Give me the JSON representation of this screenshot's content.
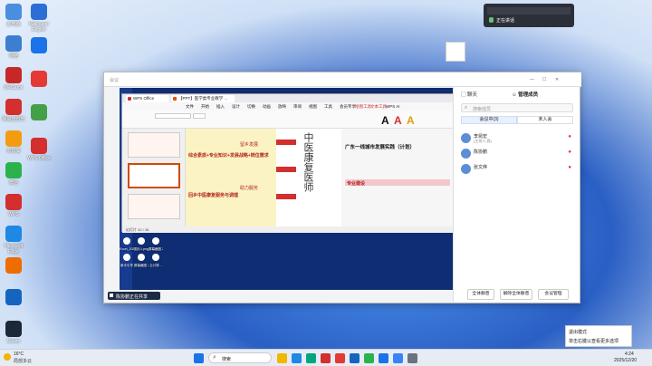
{
  "desktop": {
    "icons_left": [
      {
        "label": "此电脑",
        "color": "#4a8ee0"
      },
      {
        "label": "网络",
        "color": "#3c7fd1"
      },
      {
        "label": "WeGame",
        "color": "#c62828"
      },
      {
        "label": "网易云音乐",
        "color": "#d32f2f"
      },
      {
        "label": "向日葵",
        "color": "#f39c12"
      },
      {
        "label": "微信",
        "color": "#2bb24c"
      },
      {
        "label": "WPS",
        "color": "#d32f2f"
      },
      {
        "label": "Microsoft Edge",
        "color": "#1e88e5"
      },
      {
        "label": "",
        "color": "#ef6c00"
      },
      {
        "label": "",
        "color": "#1565c0"
      },
      {
        "label": "Steam",
        "color": "#1b2838"
      }
    ],
    "icons_left2": [
      {
        "label": "Wallpaper Engine",
        "color": "#2c6ed5"
      },
      {
        "label": "",
        "color": "#1a73e8"
      },
      {
        "label": "",
        "color": "#e53935"
      },
      {
        "label": "",
        "color": "#43a047"
      },
      {
        "label": "WPS Office",
        "color": "#d32f2f"
      }
    ]
  },
  "popup": {
    "title": "正在讲话"
  },
  "meeting": {
    "title_left": "会议",
    "share_banner": "陈协鹏正在共享",
    "sidebar": {
      "tab_chat": "聊天",
      "tab_members": "管理成员",
      "search_placeholder": "搜索成员",
      "sub_tab_in": "会议中(3)",
      "sub_tab_not": "未入会",
      "members": [
        {
          "name": "李昆宏",
          "sub": "(主持人,我)"
        },
        {
          "name": "陈协鹏",
          "sub": ""
        },
        {
          "name": "张文烨",
          "sub": ""
        }
      ],
      "btn_mute_all": "全体静音",
      "btn_unmute_all": "解除全体静音",
      "btn_manage": "会议管理"
    }
  },
  "wps": {
    "tab1": "WPS Office",
    "tab2": "【PPT】医学类专业教学 ...",
    "menu": [
      "文件",
      "开始",
      "插入",
      "设计",
      "切换",
      "动画",
      "放映",
      "审阅",
      "视图",
      "工具",
      "会员专享",
      "绘图工具",
      "文本工具",
      "WPS AI"
    ],
    "slide": {
      "big_title": "中医康复医师",
      "left_texts": [
        "综合素质+专业知识+发展战略+岗位需求",
        "留乡发展",
        "助力服务",
        "回乡中医康复服务与调理"
      ],
      "right_title": "广东一线城市发展实践（计划）",
      "right_sub": "专业建设"
    },
    "status": "幻灯片 30 / 38"
  },
  "desktop_files": [
    "Excel_202...",
    "图片1.png",
    "屏幕截图 2025...",
    "新手引导",
    "屏幕截图 2025...",
    "云计算..."
  ],
  "notification": {
    "line1": "激活 Windows",
    "line2": "转到\"设置\"以激活 Windows。"
  },
  "toast": {
    "line1": "退出模式",
    "line2": "单击右键以查看更多选项"
  },
  "taskbar": {
    "weather_temp": "16°C",
    "weather_desc": "局部多云",
    "search": "搜索",
    "time": "4:24",
    "date": "2025/12/20"
  }
}
